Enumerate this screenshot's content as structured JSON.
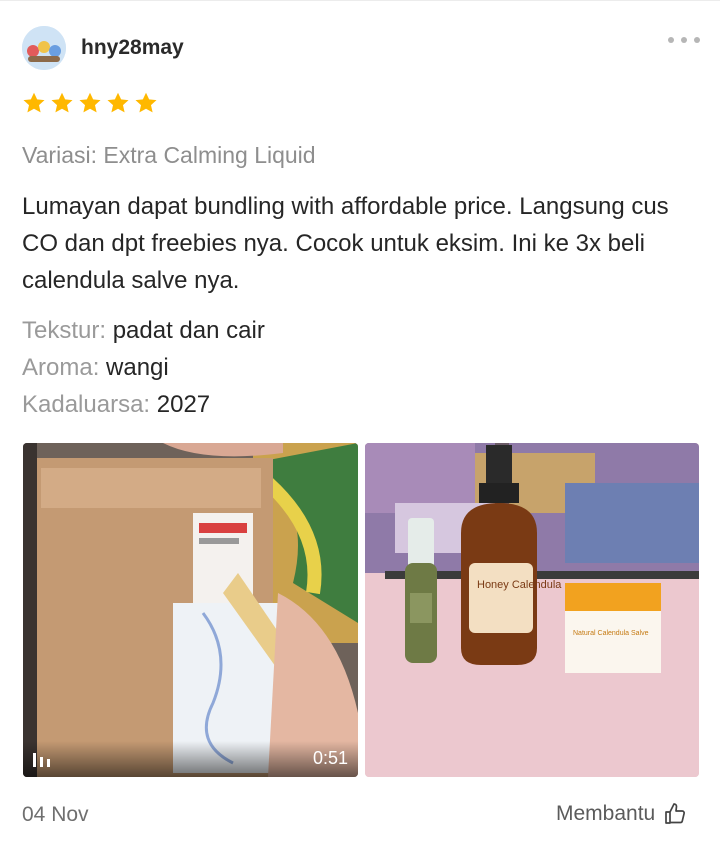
{
  "review": {
    "username": "hny28may",
    "rating": 5,
    "variation": "Variasi: Extra Calming Liquid",
    "text": "Lumayan dapat bundling with affordable price. Langsung cus CO dan dpt freebies nya. Cocok untuk eksim. Ini ke 3x beli calendula salve nya.",
    "attributes": [
      {
        "key": "Tekstur:",
        "value": "padat dan cair"
      },
      {
        "key": "Aroma:",
        "value": "wangi"
      },
      {
        "key": "Kadaluarsa:",
        "value": "2027"
      }
    ],
    "media": {
      "video_duration": "0:51",
      "product_bottle_label": "Honey Calendula",
      "product_box_label": "Natural Calendula Salve"
    },
    "date": "04 Nov",
    "helpful_label": "Membantu"
  },
  "icons": {
    "more": "more-options-icon",
    "star": "star-icon",
    "video": "video-bars-icon",
    "helpful": "thumbs-up-icon"
  },
  "colors": {
    "star": "#FFB800",
    "muted_text": "#8e8e8e",
    "body_text": "#262626"
  }
}
